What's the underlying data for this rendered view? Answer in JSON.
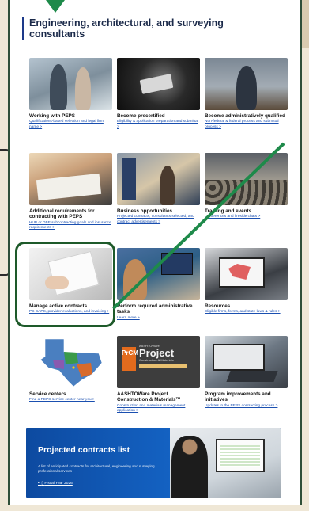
{
  "heading": "Engineering, architectural, and surveying consultants",
  "tiles": [
    {
      "title": "Working with PEPS",
      "link": "Qualifications-based selection and legal firm name >"
    },
    {
      "title": "Become precertified",
      "link": "Eligibility & application preparation and submittal >"
    },
    {
      "title": "Become administratively qualified",
      "link": "Non-federal & federal process and submittal process >"
    },
    {
      "title": "Additional requirements for contracting with PEPS",
      "link": "HUB or DBE subcontracting goals and insurance requirements >"
    },
    {
      "title": "Business opportunities",
      "link": "Projected contracts, consultants selected, and contract advertisements >"
    },
    {
      "title": "Training and events",
      "link": "Conferences and fireside chats >"
    },
    {
      "title": "Manage active contracts",
      "link": "PS CAPS, provider evaluations, and invoicing >"
    },
    {
      "title": "Perform required administrative tasks",
      "link": "Learn more >"
    },
    {
      "title": "Resources",
      "link": "Eligible firms, forms, and state laws & rules >"
    },
    {
      "title": "Service centers",
      "link": "Find a PEPS service center near you >"
    },
    {
      "title": "AASHTOWare Project Construction & Materials™",
      "link": "Construction and materials management application >"
    },
    {
      "title": "Program improvements and initiatives",
      "link": "Updates to the PEPS contracting process >"
    }
  ],
  "pcm_logo": {
    "letters": "PrCM",
    "brand": "AASHTOWare",
    "name": "Project",
    "sub": "Construction & Materials"
  },
  "banner": {
    "title": "Projected contracts list",
    "description": "A list of anticipated contracts for architectural, engineering and surveying professional services",
    "item": "Fiscal Year 2026"
  },
  "colors": {
    "accent_green": "#1e8a4a",
    "frame_green": "#2f4f39",
    "link_blue": "#1a4fb0",
    "banner_blue": "#1463c4"
  }
}
